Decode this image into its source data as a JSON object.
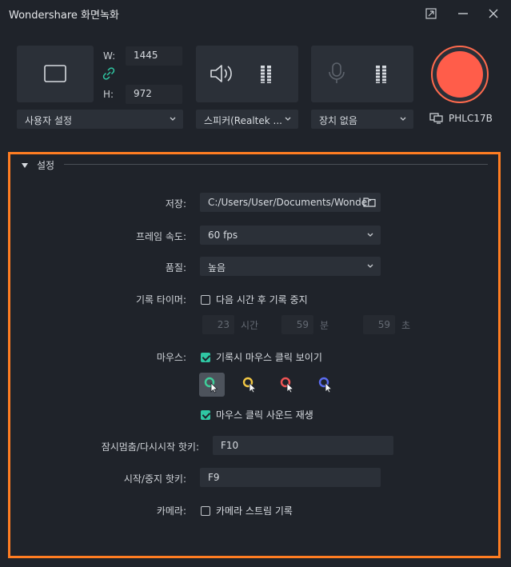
{
  "window": {
    "title": "Wondershare 화면녹화"
  },
  "capture": {
    "width_label": "W:",
    "width_value": "1445",
    "height_label": "H:",
    "height_value": "972",
    "region_dropdown": "사용자 설정"
  },
  "audio": {
    "speaker_dropdown": "스피커(Realtek ...",
    "mic_dropdown": "장치 없음"
  },
  "display": {
    "monitor_name": "PHLC17B"
  },
  "settings": {
    "section_title": "설정",
    "save_label": "저장:",
    "save_path": "C:/Users/User/Documents/Wonder",
    "framerate_label": "프레임 속도:",
    "framerate_value": "60 fps",
    "quality_label": "품질:",
    "quality_value": "높음",
    "timer_label": "기록 타이머:",
    "timer_checkbox": "다음 시간 후 기록 중지",
    "timer_hours": "23",
    "timer_hours_unit": "시간",
    "timer_minutes": "59",
    "timer_minutes_unit": "분",
    "timer_seconds": "59",
    "timer_seconds_unit": "초",
    "mouse_label": "마우스:",
    "mouse_show_clicks": "기록시 마우스 클릭 보이기",
    "mouse_click_sound": "마우스 클릭 사운드 재생",
    "pause_hotkey_label": "잠시멈춤/다시시작 핫키:",
    "pause_hotkey_value": "F10",
    "start_hotkey_label": "시작/중지 핫키:",
    "start_hotkey_value": "F9",
    "camera_label": "카메라:",
    "camera_checkbox": "카메라 스트림 기록"
  },
  "colors": {
    "accent_orange": "#ff7d22",
    "record_red": "#ff5d4a",
    "check_green": "#2fc7a3",
    "cursor_green": "#3fcf9a",
    "cursor_yellow": "#f2c744",
    "cursor_red": "#f05454",
    "cursor_blue": "#5b6cf0"
  }
}
